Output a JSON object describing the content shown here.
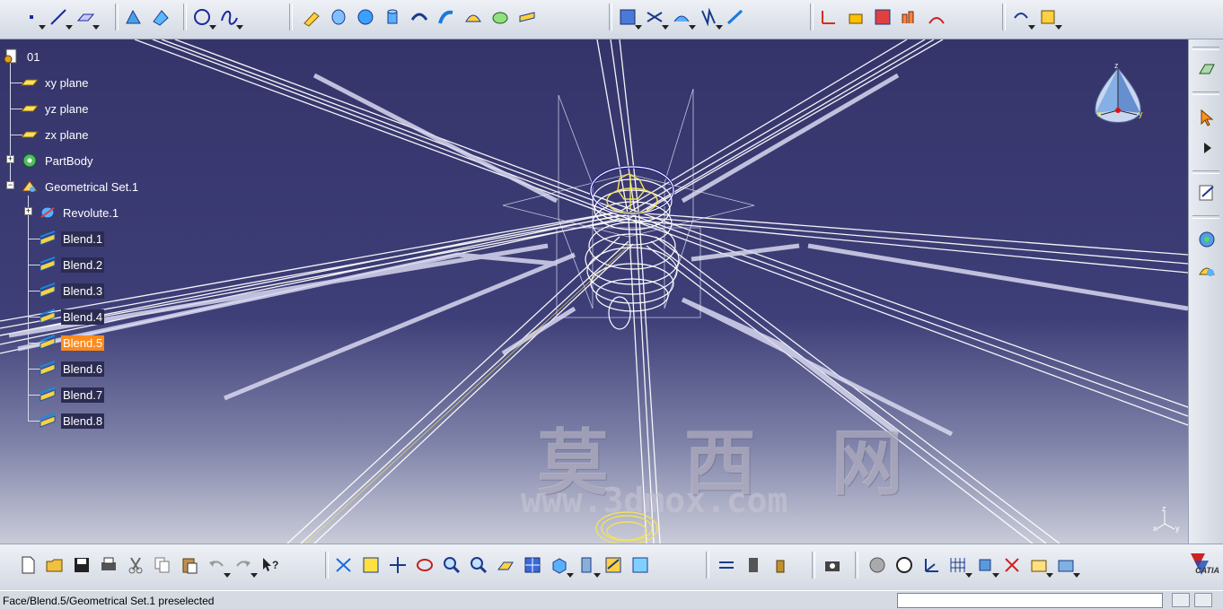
{
  "tree": {
    "root": "01",
    "items": [
      {
        "label": "xy plane",
        "icon": "plane-icon"
      },
      {
        "label": "yz plane",
        "icon": "plane-icon"
      },
      {
        "label": "zx plane",
        "icon": "plane-icon"
      },
      {
        "label": "PartBody",
        "icon": "gear-body-icon"
      },
      {
        "label": "Geometrical Set.1",
        "icon": "geometrical-set-icon"
      },
      {
        "label": "Revolute.1",
        "icon": "revolute-icon"
      },
      {
        "label": "Blend.1",
        "icon": "blend-surface-icon"
      },
      {
        "label": "Blend.2",
        "icon": "blend-surface-icon"
      },
      {
        "label": "Blend.3",
        "icon": "blend-surface-icon"
      },
      {
        "label": "Blend.4",
        "icon": "blend-surface-icon"
      },
      {
        "label": "Blend.5",
        "icon": "blend-surface-icon"
      },
      {
        "label": "Blend.6",
        "icon": "blend-surface-icon"
      },
      {
        "label": "Blend.7",
        "icon": "blend-surface-icon"
      },
      {
        "label": "Blend.8",
        "icon": "blend-surface-icon"
      }
    ],
    "selected": "Blend.5"
  },
  "status": {
    "message": "Face/Blend.5/Geometrical Set.1 preselected"
  },
  "watermark": {
    "title": "莫 西 网",
    "url": "www.3dmox.com"
  },
  "compass": {
    "x": "x",
    "y": "y",
    "z": "z"
  },
  "mini_axis": {
    "x": "x",
    "y": "y",
    "z": "z"
  },
  "brand": {
    "logo_text": "CATIA"
  },
  "colors": {
    "viewport_top": "#35346a",
    "selection": "#ff8a1c",
    "geometry": "#ffffff",
    "accent_yellow": "#f0e060"
  }
}
